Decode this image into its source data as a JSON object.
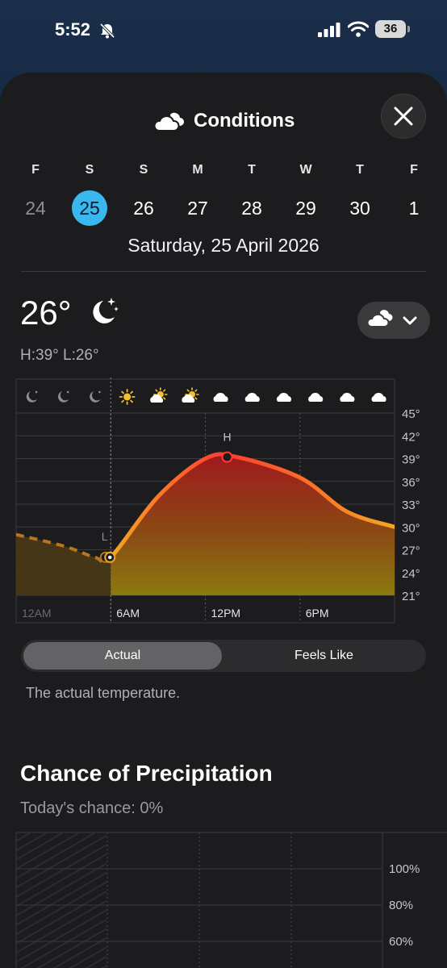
{
  "status": {
    "time": "5:52",
    "battery": "36"
  },
  "header": {
    "title": "Conditions"
  },
  "days": [
    {
      "letter": "F",
      "num": "24"
    },
    {
      "letter": "S",
      "num": "25"
    },
    {
      "letter": "S",
      "num": "26"
    },
    {
      "letter": "M",
      "num": "27"
    },
    {
      "letter": "T",
      "num": "28"
    },
    {
      "letter": "W",
      "num": "29"
    },
    {
      "letter": "T",
      "num": "30"
    },
    {
      "letter": "F",
      "num": "1"
    }
  ],
  "selected_day_index": 1,
  "date_line": "Saturday, 25 April 2026",
  "current": {
    "temp": "26°",
    "high_low": "H:39° L:26°"
  },
  "chart_data": {
    "type": "area",
    "x": [
      0,
      3,
      5,
      6,
      9,
      12,
      14,
      18,
      21,
      24
    ],
    "x_unit": "hour",
    "values": [
      29,
      27.5,
      26,
      26,
      34,
      39,
      39.2,
      36.5,
      32,
      30
    ],
    "high_hour": 12,
    "high_label": "H",
    "low_hour": 5,
    "low_label": "L",
    "ylim": [
      21,
      46
    ],
    "y_ticks": [
      "45°",
      "42°",
      "39°",
      "36°",
      "33°",
      "30°",
      "27°",
      "24°",
      "21°"
    ],
    "x_ticks": [
      "12AM",
      "6AM",
      "12PM",
      "6PM"
    ],
    "hour_icons": [
      "moon",
      "moon",
      "moon",
      "sun",
      "sun-cloud",
      "sun-cloud",
      "cloud",
      "cloud",
      "cloud",
      "cloud",
      "cloud",
      "cloud"
    ],
    "colors": {
      "line_start": "#f5a623",
      "line_end": "#ff3b30",
      "past": "#b87420",
      "grid": "#3a3a3c"
    }
  },
  "segment": {
    "actual": "Actual",
    "feels_like": "Feels Like"
  },
  "description": "The actual temperature.",
  "precipitation": {
    "title": "Chance of Precipitation",
    "subtitle": "Today's chance: 0%",
    "y_ticks": [
      "100%",
      "80%",
      "60%"
    ]
  }
}
